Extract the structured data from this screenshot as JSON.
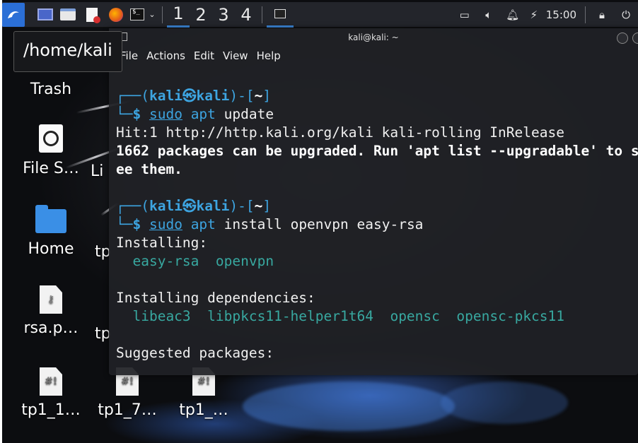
{
  "panel": {
    "workspaces": [
      "1",
      "2",
      "3",
      "4"
    ],
    "active_workspace": "1",
    "clock": "15:00",
    "accent_color": "#3d8be0"
  },
  "tooltip": {
    "text": "/home/kali"
  },
  "desktop_icons": [
    {
      "label": "Trash",
      "icon": "trash-icon"
    },
    {
      "label": "File S…",
      "icon": "filesystem-icon"
    },
    {
      "label": "Home",
      "icon": "home-folder-icon"
    },
    {
      "label": "rsa.p…",
      "icon": "key-file-icon"
    },
    {
      "label": "tp1_1…",
      "icon": "script-file-icon"
    },
    {
      "label": "tp1_7…",
      "icon": "script-file-icon"
    },
    {
      "label": "tp1_…",
      "icon": "script-file-icon"
    },
    {
      "label": "Li",
      "icon": "file-icon"
    },
    {
      "label": "tp",
      "icon": "file-icon"
    },
    {
      "label": "tp",
      "icon": "file-icon"
    }
  ],
  "terminal": {
    "title": "kali@kali: ~",
    "menu": [
      "File",
      "Actions",
      "Edit",
      "View",
      "Help"
    ],
    "prompt_user": "kali",
    "prompt_sep": "㉿",
    "prompt_host": "kali",
    "prompt_path": "~",
    "cmd1_sudo": "sudo",
    "cmd1_apt": "apt",
    "cmd1_rest": " update",
    "out1": "Hit:1 http://http.kali.org/kali kali-rolling InRelease",
    "out2": "1662 packages can be upgraded. Run 'apt list --upgradable' to s",
    "out3": "ee them.",
    "cmd2_sudo": "sudo",
    "cmd2_apt": "apt",
    "cmd2_rest": " install openvpn easy-rsa",
    "out4": "Installing:",
    "pkgs1": [
      "easy-rsa",
      "openvpn"
    ],
    "out5": "Installing dependencies:",
    "pkgs2": [
      "libeac3",
      "libpkcs11-helper1t64",
      "opensc",
      "opensc-pkcs11"
    ],
    "out6": "Suggested packages:"
  }
}
